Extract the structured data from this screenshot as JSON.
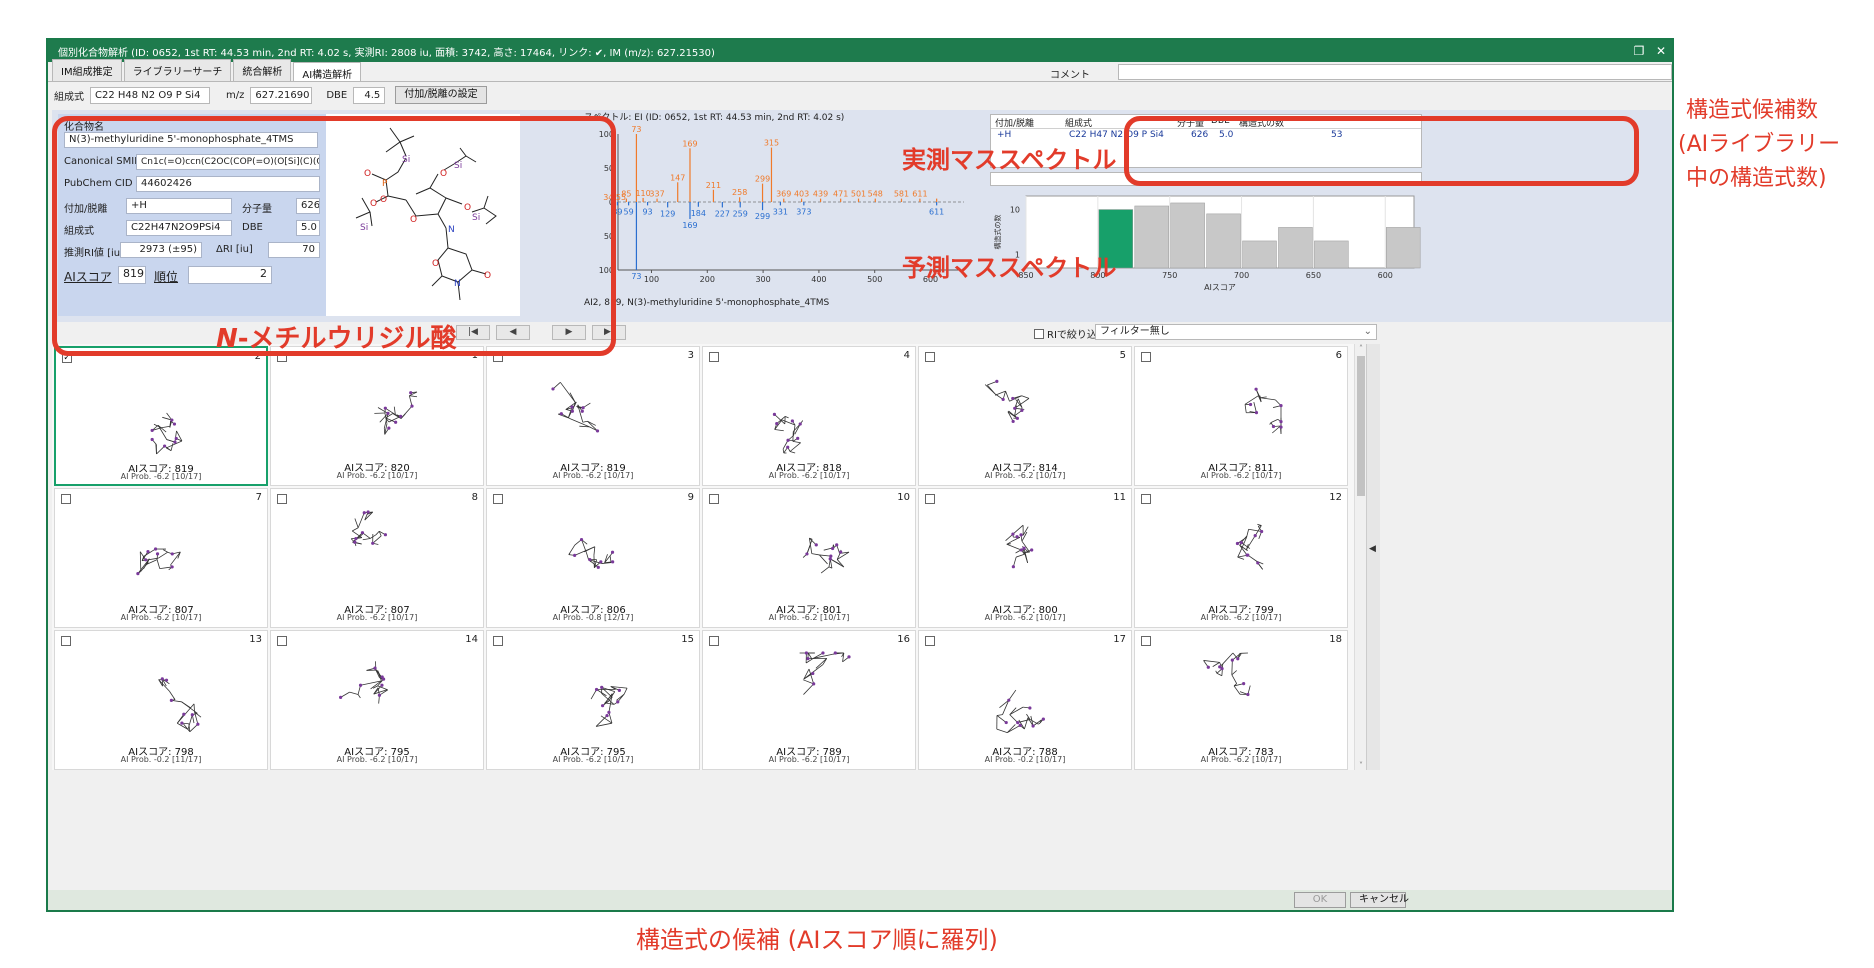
{
  "window": {
    "title": "個別化合物解析 (ID: 0652, 1st RT: 44.53 min, 2nd RT: 4.02 s, 実測RI: 2808 iu, 面積: 3742, 高さ: 17464, リンク: ✔, IM (m/z): 627.21530)",
    "restore_icon": "restore-icon",
    "close_icon": "close-icon"
  },
  "tabs": [
    "IM組成推定",
    "ライブラリーサーチ",
    "統合解析",
    "AI構造解析"
  ],
  "comment_label": "コメント",
  "formula_row": {
    "formula_label": "組成式",
    "formula_value": "C22 H48 N2 O9 P Si4",
    "mz_label": "m/z",
    "mz_value": "627.21690",
    "dbe_label": "DBE",
    "dbe_value": "4.5",
    "adduct_button": "付加/脱離の設定"
  },
  "compound": {
    "name_label": "化合物名",
    "name_value": "N(3)-methyluridine 5'-monophosphate_4TMS",
    "smiles_label": "Canonical SMILES",
    "smiles_value": "Cn1c(=O)ccn(C2OC(COP(=O)(O[Si](C)(C)C)O[Si]",
    "pubchem_label": "PubChem CID",
    "pubchem_value": "44602426",
    "adduct_label": "付加/脱離",
    "adduct_value": "+H",
    "mw_label": "分子量",
    "mw_value": "626",
    "formula_label": "組成式",
    "formula_value": "C22H47N2O9PSi4",
    "dbe_label": "DBE",
    "dbe_value": "5.0",
    "ri_label": "推測RI値 [iu]",
    "ri_value": "2973 (±95)",
    "dri_label": "ΔRI [iu]",
    "dri_value": "70",
    "ai_score_label": "AIスコア",
    "ai_score_value": "819",
    "rank_label": "順位",
    "rank_value": "2"
  },
  "spectrum": {
    "title": "スペクトル: EI (ID: 0652, 1st RT: 44.53 min, 2nd RT: 4.02 s)",
    "caption": "AI2, 819, N(3)-methyluridine 5'-monophosphate_4TMS",
    "measured_color": "#f07a2a",
    "predicted_color": "#2a6fd0"
  },
  "chart_data": [
    {
      "type": "bar",
      "name": "mirror-spectrum",
      "xlim": [
        40,
        660
      ],
      "ylim": [
        -100,
        100
      ],
      "x_ticks": [
        "100",
        "200",
        "300",
        "400",
        "500",
        "600"
      ],
      "y_ticks": [
        "100",
        "50",
        "0",
        "50",
        "100"
      ],
      "series": [
        {
          "name": "measured",
          "points": [
            [
              73,
              100
            ],
            [
              147,
              29
            ],
            [
              169,
              79
            ],
            [
              211,
              18
            ],
            [
              258,
              7
            ],
            [
              299,
              27
            ],
            [
              315,
              80
            ],
            [
              34,
              0
            ],
            [
              55,
              5
            ],
            [
              85,
              6
            ],
            [
              110,
              5
            ],
            [
              337,
              5
            ],
            [
              369,
              5
            ],
            [
              403,
              5
            ],
            [
              439,
              5
            ],
            [
              471,
              5
            ],
            [
              501,
              5
            ],
            [
              548,
              5
            ],
            [
              581,
              5
            ],
            [
              611,
              5
            ]
          ],
          "labels": [
            "73",
            "147",
            "169",
            "211",
            "258",
            "299",
            "315",
            "34 55",
            "85",
            "110",
            "337",
            "369",
            "403",
            "439",
            "471",
            "501",
            "548",
            "581",
            "611"
          ]
        },
        {
          "name": "predicted",
          "points": [
            [
              73,
              -100
            ],
            [
              39,
              -5
            ],
            [
              59,
              -5
            ],
            [
              93,
              -5
            ],
            [
              129,
              -8
            ],
            [
              169,
              -25
            ],
            [
              184,
              -7
            ],
            [
              227,
              -8
            ],
            [
              259,
              -8
            ],
            [
              299,
              -12
            ],
            [
              331,
              -5
            ],
            [
              373,
              -5
            ],
            [
              611,
              -5
            ]
          ],
          "labels": [
            "73",
            "39",
            "59",
            "93",
            "129",
            "169",
            "184",
            "227",
            "259",
            "299",
            "331",
            "373",
            "611"
          ]
        }
      ]
    },
    {
      "type": "bar",
      "name": "candidate-histogram",
      "xlabel": "AIスコア",
      "ylabel": "構造式の数",
      "y_scale": "log",
      "xlim": [
        850,
        580
      ],
      "x_ticks": [
        "850",
        "800",
        "750",
        "700",
        "650",
        "600"
      ],
      "y_ticks": [
        "10",
        "1"
      ],
      "bins": [
        [
          800,
          775,
          10
        ],
        [
          775,
          750,
          12
        ],
        [
          750,
          725,
          14
        ],
        [
          725,
          700,
          8
        ],
        [
          700,
          675,
          2
        ],
        [
          675,
          650,
          4
        ],
        [
          650,
          625,
          2
        ],
        [
          600,
          575,
          4
        ]
      ],
      "highlight_bin": 0
    }
  ],
  "candidate_table": {
    "headers": [
      "付加/脱離",
      "組成式",
      "分子量",
      "DBE",
      "構造式の数"
    ],
    "rows": [
      [
        "+H",
        "C22 H47 N2 O9 P Si4",
        "626",
        "5.0",
        "53"
      ]
    ]
  },
  "nav": {
    "first": "|◀",
    "prev": "◀",
    "next": "▶",
    "last": "▶|",
    "ri_filter_label": "RIで絞り込む",
    "filter_value": "フィルター無し"
  },
  "cards": [
    {
      "rank": "2",
      "score": "AIスコア: 819",
      "prob": "AI Prob. -6.2 [10/17]",
      "checked": true
    },
    {
      "rank": "1",
      "score": "AIスコア: 820",
      "prob": "AI Prob. -6.2 [10/17]",
      "checked": false
    },
    {
      "rank": "3",
      "score": "AIスコア: 819",
      "prob": "AI Prob. -6.2 [10/17]",
      "checked": false
    },
    {
      "rank": "4",
      "score": "AIスコア: 818",
      "prob": "AI Prob. -6.2 [10/17]",
      "checked": false
    },
    {
      "rank": "5",
      "score": "AIスコア: 814",
      "prob": "AI Prob. -6.2 [10/17]",
      "checked": false
    },
    {
      "rank": "6",
      "score": "AIスコア: 811",
      "prob": "AI Prob. -6.2 [10/17]",
      "checked": false
    },
    {
      "rank": "7",
      "score": "AIスコア: 807",
      "prob": "AI Prob. -6.2 [10/17]",
      "checked": false
    },
    {
      "rank": "8",
      "score": "AIスコア: 807",
      "prob": "AI Prob. -6.2 [10/17]",
      "checked": false
    },
    {
      "rank": "9",
      "score": "AIスコア: 806",
      "prob": "AI Prob. -0.8 [12/17]",
      "checked": false
    },
    {
      "rank": "10",
      "score": "AIスコア: 801",
      "prob": "AI Prob. -6.2 [10/17]",
      "checked": false
    },
    {
      "rank": "11",
      "score": "AIスコア: 800",
      "prob": "AI Prob. -6.2 [10/17]",
      "checked": false
    },
    {
      "rank": "12",
      "score": "AIスコア: 799",
      "prob": "AI Prob. -6.2 [10/17]",
      "checked": false
    },
    {
      "rank": "13",
      "score": "AIスコア: 798",
      "prob": "AI Prob. -0.2 [11/17]",
      "checked": false
    },
    {
      "rank": "14",
      "score": "AIスコア: 795",
      "prob": "AI Prob. -6.2 [10/17]",
      "checked": false
    },
    {
      "rank": "15",
      "score": "AIスコア: 795",
      "prob": "AI Prob. -6.2 [10/17]",
      "checked": false
    },
    {
      "rank": "16",
      "score": "AIスコア: 789",
      "prob": "AI Prob. -6.2 [10/17]",
      "checked": false
    },
    {
      "rank": "17",
      "score": "AIスコア: 788",
      "prob": "AI Prob. -0.2 [10/17]",
      "checked": false
    },
    {
      "rank": "18",
      "score": "AIスコア: 783",
      "prob": "AI Prob. -6.2 [10/17]",
      "checked": false
    }
  ],
  "footer": {
    "ok": "OK",
    "cancel": "キャンセル"
  },
  "annotations": {
    "compound_name": "N-メチルウリジル酸",
    "compound_name_italic_prefix": "N",
    "compound_name_rest": "-メチルウリジル酸",
    "measured": "実測マススペクトル",
    "predicted": "予測マススペクトル",
    "side_line1": "構造式候補数",
    "side_line2": "(AIライブラリー",
    "side_line3": "中の構造式数)",
    "bottom": "構造式の候補 (AIスコア順に羅列)",
    "color": "#e23b2a"
  }
}
